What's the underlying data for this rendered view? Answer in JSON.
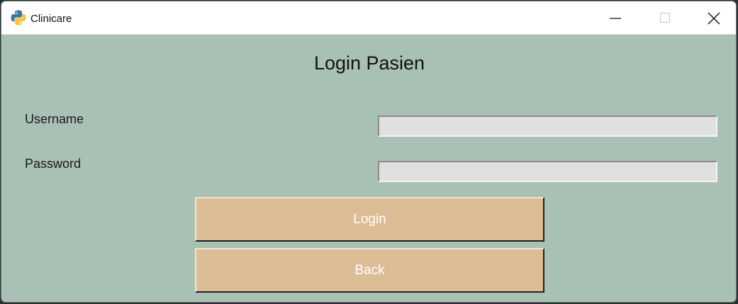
{
  "window": {
    "title": "Clinicare",
    "app_icon": "python-logo-icon",
    "controls": [
      "minimize-icon",
      "maximize-icon",
      "close-icon"
    ]
  },
  "form": {
    "heading": "Login Pasien",
    "username_label": "Username",
    "username_value": "",
    "password_label": "Password",
    "password_value": "",
    "login_button": "Login",
    "back_button": "Back"
  },
  "colors": {
    "background": "#a9c0b4",
    "button": "#dcbd96",
    "button_text": "#ffffff",
    "field": "#dfe0df"
  }
}
